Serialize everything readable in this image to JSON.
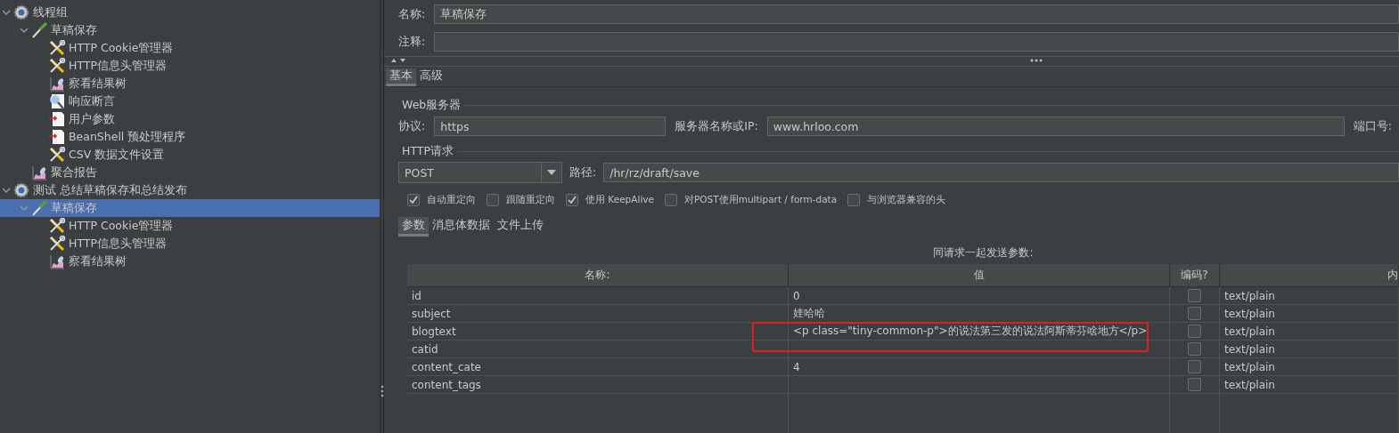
{
  "tree": [
    {
      "label": "线程组",
      "kind": "thread-group",
      "selected": false,
      "expanded": true,
      "children": [
        {
          "label": "草稿保存",
          "kind": "sampler",
          "selected": false,
          "expanded": true,
          "children": [
            {
              "label": "HTTP Cookie管理器",
              "kind": "config",
              "selected": false
            },
            {
              "label": "HTTP信息头管理器",
              "kind": "config",
              "selected": false
            },
            {
              "label": "察看结果树",
              "kind": "listener",
              "selected": false
            },
            {
              "label": "响应断言",
              "kind": "assertion",
              "selected": false
            },
            {
              "label": "用户参数",
              "kind": "preprocessor",
              "selected": false
            },
            {
              "label": "BeanShell 预处理程序",
              "kind": "preprocessor",
              "selected": false
            },
            {
              "label": "CSV 数据文件设置",
              "kind": "config",
              "selected": false
            }
          ]
        },
        {
          "label": "聚合报告",
          "kind": "listener",
          "selected": false
        }
      ]
    },
    {
      "label": "测试 总结草稿保存和总结发布",
      "kind": "thread-group",
      "selected": false,
      "expanded": true,
      "children": [
        {
          "label": "草稿保存",
          "kind": "sampler",
          "selected": true,
          "expanded": true,
          "children": [
            {
              "label": "HTTP Cookie管理器",
              "kind": "config",
              "selected": false
            },
            {
              "label": "HTTP信息头管理器",
              "kind": "config",
              "selected": false
            },
            {
              "label": "察看结果树",
              "kind": "listener",
              "selected": false
            }
          ]
        }
      ]
    }
  ],
  "name_field": {
    "label": "名称:",
    "value": "草稿保存"
  },
  "comment_field": {
    "label": "注释:"
  },
  "tabs": [
    {
      "label": "基本",
      "selected": true
    },
    {
      "label": "高级",
      "selected": false
    }
  ],
  "web_server": {
    "title": "Web服务器",
    "protocol_label": "协议:",
    "protocol": "https",
    "server_label": "服务器名称或IP:",
    "server": "www.hrloo.com",
    "port_label": "端口号:"
  },
  "http_request": {
    "title": "HTTP请求",
    "method": "POST",
    "path_label": "路径:",
    "path": "/hr/rz/draft/save"
  },
  "options": [
    {
      "label": "自动重定向",
      "checked": true
    },
    {
      "label": "跟随重定向",
      "checked": false
    },
    {
      "label": "使用 KeepAlive",
      "checked": true
    },
    {
      "label": "对POST使用multipart / form-data",
      "checked": false
    },
    {
      "label": "与浏览器兼容的头",
      "checked": false
    }
  ],
  "sub_tabs": [
    {
      "label": "参数",
      "selected": true
    },
    {
      "label": "消息体数据",
      "selected": false
    },
    {
      "label": "文件上传",
      "selected": false
    }
  ],
  "table": {
    "title": "同请求一起发送参数:",
    "columns": [
      "名称:",
      "值",
      "编码?",
      "内"
    ],
    "rows": [
      {
        "name": "id",
        "value": "0",
        "encode": false,
        "content_type": "text/plain"
      },
      {
        "name": "subject",
        "value": "娃哈哈",
        "encode": false,
        "content_type": "text/plain"
      },
      {
        "name": "blogtext",
        "value": "<p class=\"tiny-common-p\">的说法第三发的说法阿斯蒂芬啥地方</p>",
        "encode": false,
        "content_type": "text/plain"
      },
      {
        "name": "catid",
        "encode": false,
        "content_type": "text/plain"
      },
      {
        "name": "content_cate",
        "value": "4",
        "encode": false,
        "content_type": "text/plain"
      },
      {
        "name": "content_tags",
        "encode": false,
        "content_type": "text/plain"
      }
    ]
  }
}
